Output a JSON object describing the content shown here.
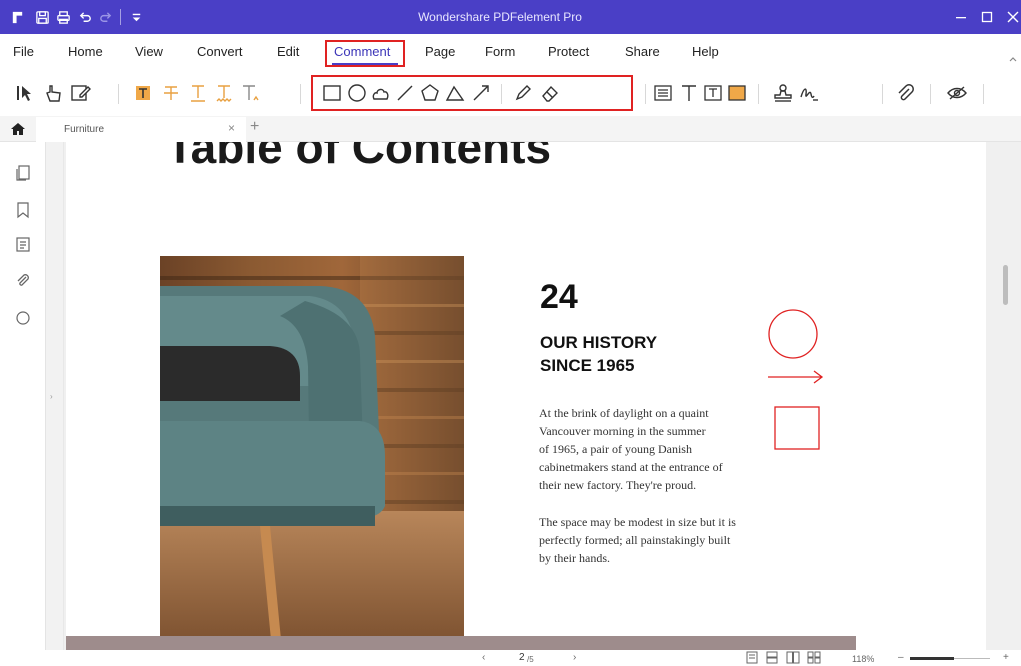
{
  "app": {
    "title": "Wondershare PDFelement Pro"
  },
  "menu": [
    {
      "label": "File",
      "active": false
    },
    {
      "label": "Home",
      "active": false
    },
    {
      "label": "View",
      "active": false
    },
    {
      "label": "Convert",
      "active": false
    },
    {
      "label": "Edit",
      "active": false
    },
    {
      "label": "Comment",
      "active": true
    },
    {
      "label": "Page",
      "active": false
    },
    {
      "label": "Form",
      "active": false
    },
    {
      "label": "Protect",
      "active": false
    },
    {
      "label": "Share",
      "active": false
    },
    {
      "label": "Help",
      "active": false
    }
  ],
  "toolbar": {
    "icons": [
      "select-cursor-icon",
      "hand-icon",
      "edit-icon",
      "highlight-icon",
      "strikethrough-icon",
      "underline-icon",
      "squiggly-underline-icon",
      "caret-insert-icon",
      "rectangle-icon",
      "oval-icon",
      "cloud-icon",
      "line-icon",
      "polygon-icon",
      "polyline-icon",
      "arrow-icon",
      "pencil-icon",
      "eraser-icon",
      "note-icon",
      "typewriter-icon",
      "textbox-icon",
      "callout-icon",
      "stamp-icon",
      "signature-icon",
      "attachment-icon",
      "hide-comments-icon"
    ]
  },
  "tabs": {
    "document_tab": "Furniture",
    "close": "×",
    "add": "+"
  },
  "document": {
    "heading": "Table of Contents",
    "number": "24",
    "history_line1": "OUR HISTORY",
    "history_line2": "SINCE 1965",
    "para1": [
      "At the brink of daylight on a quaint",
      "Vancouver morning in the summer",
      "of 1965, a pair of young Danish",
      "cabinetmakers stand at the entrance of",
      "their new factory. They're proud."
    ],
    "para2": [
      "The space may be modest in size but it is",
      "perfectly formed; all painstakingly built",
      "by their hands."
    ]
  },
  "statusbar": {
    "prev": "‹",
    "page": "2",
    "total": "/5",
    "next": "›",
    "zoom": "118%",
    "zoom_minus": "–",
    "zoom_plus": "+",
    "zoom_level": 0.55
  },
  "colors": {
    "titlebar": "#4a3fc6",
    "highlight_box": "#e02222",
    "annotation": "#e02222",
    "accent": "#e8a040"
  }
}
